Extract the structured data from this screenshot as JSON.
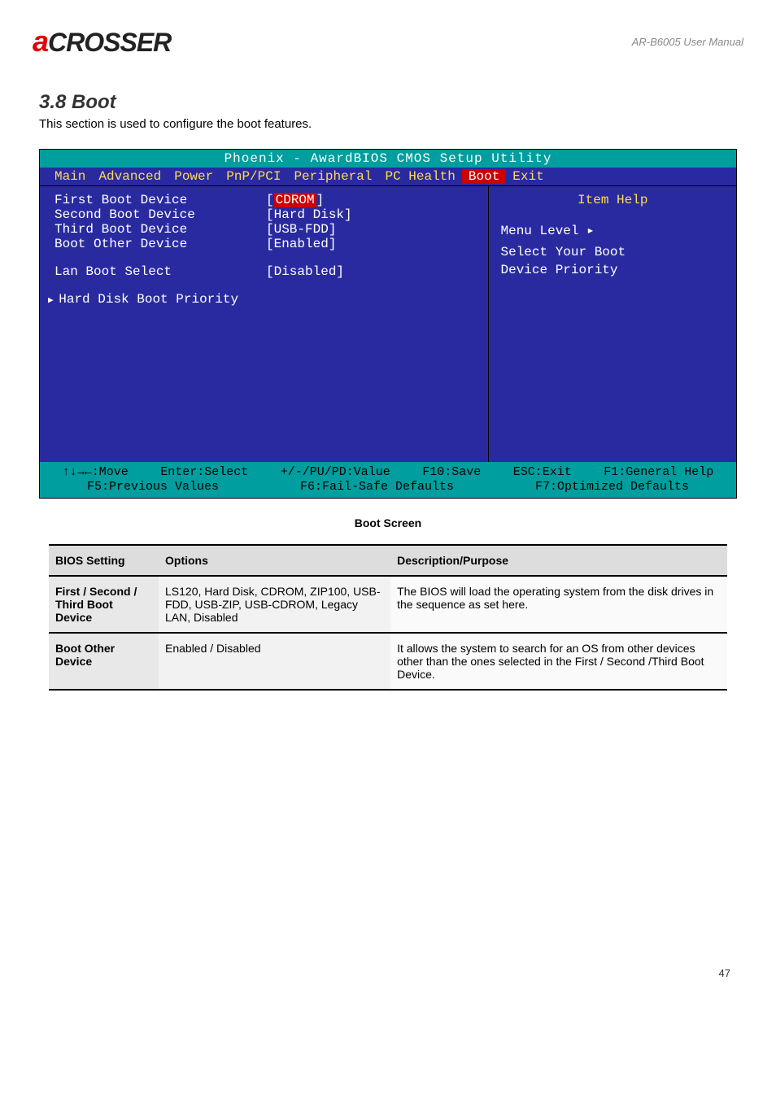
{
  "header": {
    "logo_a": "a",
    "logo_rest": "CROSSER",
    "model": "AR-B6005 User Manual"
  },
  "section": {
    "title": "3.8 Boot",
    "subtitle": "This section is used to configure the boot features."
  },
  "bios": {
    "title": "Phoenix - AwardBIOS CMOS Setup Utility",
    "menu": [
      "Main",
      "Advanced",
      "Power",
      "PnP/PCI",
      "Peripheral",
      "PC Health",
      "Boot",
      "Exit"
    ],
    "active": "Boot",
    "rows": [
      {
        "label": "First Boot Device",
        "value": "CDROM",
        "selected": true,
        "bracket": true
      },
      {
        "label": "Second Boot Device",
        "value": "[Hard Disk]"
      },
      {
        "label": "Third Boot Device",
        "value": "[USB-FDD]"
      },
      {
        "label": "Boot Other Device",
        "value": "[Enabled]"
      },
      {
        "gap": true
      },
      {
        "label": "Lan Boot Select",
        "value": "[Disabled]"
      },
      {
        "gap": true
      },
      {
        "submenu": true,
        "label": "Hard Disk Boot Priority"
      }
    ],
    "help": {
      "title": "Item Help",
      "lines": [
        "Menu Level  ▸",
        "",
        "Select Your Boot",
        "Device Priority"
      ]
    },
    "foot": {
      "line1": [
        "↑↓→←:Move",
        "Enter:Select",
        "+/-/PU/PD:Value",
        "F10:Save",
        "ESC:Exit",
        "F1:General Help"
      ],
      "line2": [
        "F5:Previous Values",
        "F6:Fail-Safe Defaults",
        "F7:Optimized Defaults"
      ]
    }
  },
  "bios_label": "Boot Screen",
  "table": {
    "headers": [
      "BIOS Setting",
      "Options",
      "Description/Purpose"
    ],
    "rows": [
      {
        "setting": "First / Second / Third Boot Device",
        "options": "LS120, Hard Disk, CDROM, ZIP100, USB-FDD, USB-ZIP, USB-CDROM, Legacy LAN, Disabled",
        "desc": "The BIOS will load the operating system from the disk drives in the sequence as set here."
      },
      {
        "setting": "Boot Other Device",
        "options": "Enabled / Disabled",
        "desc": "It allows the system to search for an OS from other devices other than the ones selected in the First / Second /Third Boot Device."
      }
    ]
  },
  "page_num": "47"
}
